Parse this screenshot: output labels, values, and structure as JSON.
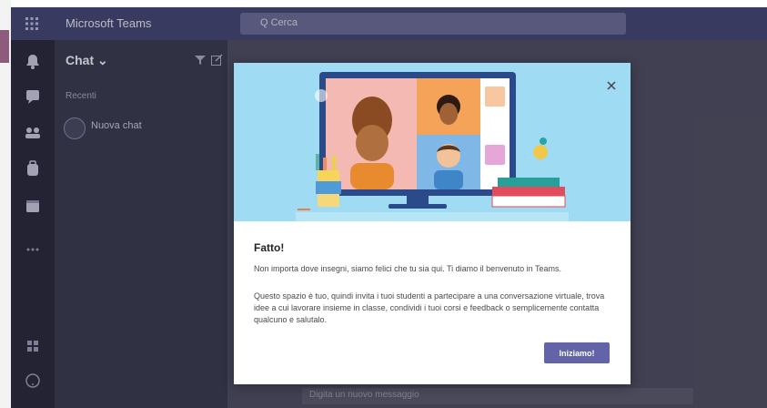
{
  "app": {
    "title": "Microsoft Teams"
  },
  "search": {
    "placeholder": "Q Cerca"
  },
  "rail": [
    {
      "name": "activity",
      "icon": "bell-icon"
    },
    {
      "name": "chat",
      "icon": "chat-icon"
    },
    {
      "name": "teams",
      "icon": "teams-icon"
    },
    {
      "name": "assignments",
      "icon": "backpack-icon"
    },
    {
      "name": "calendar",
      "icon": "calendar-icon"
    },
    {
      "name": "more",
      "icon": "ellipsis-icon"
    },
    {
      "name": "apps",
      "icon": "apps-icon"
    },
    {
      "name": "help",
      "icon": "help-icon"
    }
  ],
  "chatlist": {
    "title": "Chat ⌄",
    "section": "Recenti",
    "items": [
      {
        "name": "Nuova chat"
      }
    ]
  },
  "main": {
    "compose_placeholder": "Digita un nuovo messaggio"
  },
  "dialog": {
    "title": "Fatto!",
    "paragraph1": "Non importa dove insegni, siamo felici che tu sia qui. Ti diamo il benvenuto in Teams.",
    "paragraph2": "Questo spazio è tuo, quindi invita i tuoi studenti a partecipare a una conversazione virtuale, trova idee a cui lavorare insieme in classe, condividi i tuoi corsi e feedback o semplicemente contatta qualcuno e salutalo.",
    "button": "Iniziamo!"
  },
  "colors": {
    "accent": "#6264a7",
    "titlebar": "#464775",
    "rail": "#2b2b40",
    "hero": "#9fdcf3"
  }
}
